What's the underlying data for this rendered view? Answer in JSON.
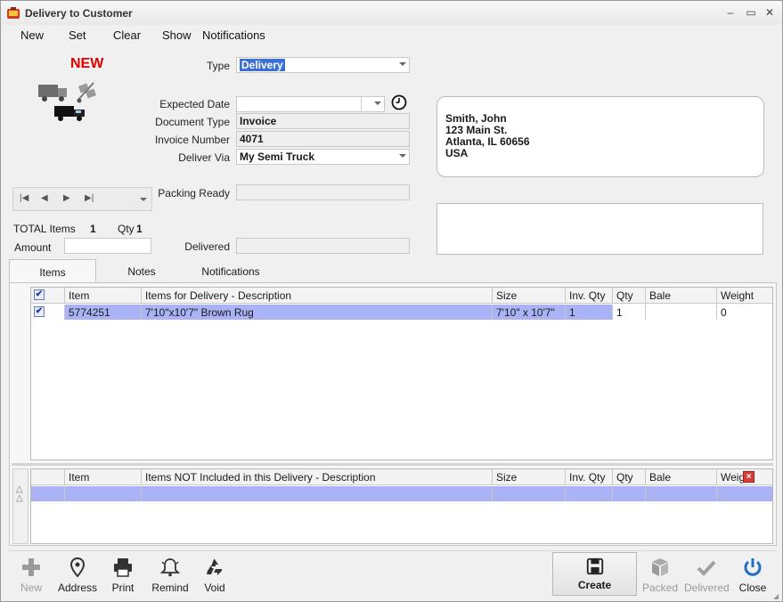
{
  "window": {
    "title": "Delivery to Customer",
    "controls": [
      "–",
      "▭",
      "✕"
    ]
  },
  "menu": [
    "New",
    "Set",
    "Clear",
    "Show",
    "Notifications"
  ],
  "status_label": "NEW",
  "form": {
    "type_label": "Type",
    "type_value": "Delivery",
    "expected_date_label": "Expected Date",
    "expected_date_value": "",
    "document_type_label": "Document Type",
    "document_type_value": "Invoice",
    "invoice_number_label": "Invoice Number",
    "invoice_number_value": "4071",
    "deliver_via_label": "Deliver Via",
    "deliver_via_value": "My Semi Truck",
    "packing_ready_label": "Packing Ready",
    "packing_ready_value": "",
    "delivered_label": "Delivered",
    "delivered_value": ""
  },
  "address": {
    "line1": "Smith, John",
    "line2": "123 Main St.",
    "line3": "Atlanta, IL 60656",
    "line4": "USA"
  },
  "totals": {
    "total_items_label": "TOTAL Items",
    "total_items_value": "1",
    "qty_label": "Qty",
    "qty_value": "1",
    "amount_label": "Amount",
    "amount_value": ""
  },
  "tabs": [
    "Items",
    "Notes",
    "Notifications"
  ],
  "items_grid": {
    "headers": [
      "",
      "Item",
      "Items for Delivery - Description",
      "Size",
      "Inv. Qty",
      "Qty",
      "Bale",
      "Weight"
    ],
    "rows": [
      {
        "checked": "✔",
        "item": "5774251",
        "description": "7'10\"x10'7\" Brown Rug",
        "size": "7'10\" x 10'7\"",
        "inv_qty": "1",
        "qty": "1",
        "bale": "",
        "weight": "0"
      }
    ]
  },
  "excluded_grid": {
    "headers": [
      "Item",
      "Items NOT Included in this Delivery - Description",
      "Size",
      "Inv. Qty",
      "Qty",
      "Bale",
      "Weig"
    ]
  },
  "toolbar": {
    "new": "New",
    "address": "Address",
    "print": "Print",
    "remind": "Remind",
    "void": "Void",
    "create": "Create",
    "packed": "Packed",
    "delivered": "Delivered",
    "close": "Close"
  },
  "colors": {
    "accent_red": "#e00000",
    "selection_blue": "#3b6fd8",
    "row_highlight": "#aab3f5",
    "close_blue": "#1f6fc4"
  }
}
